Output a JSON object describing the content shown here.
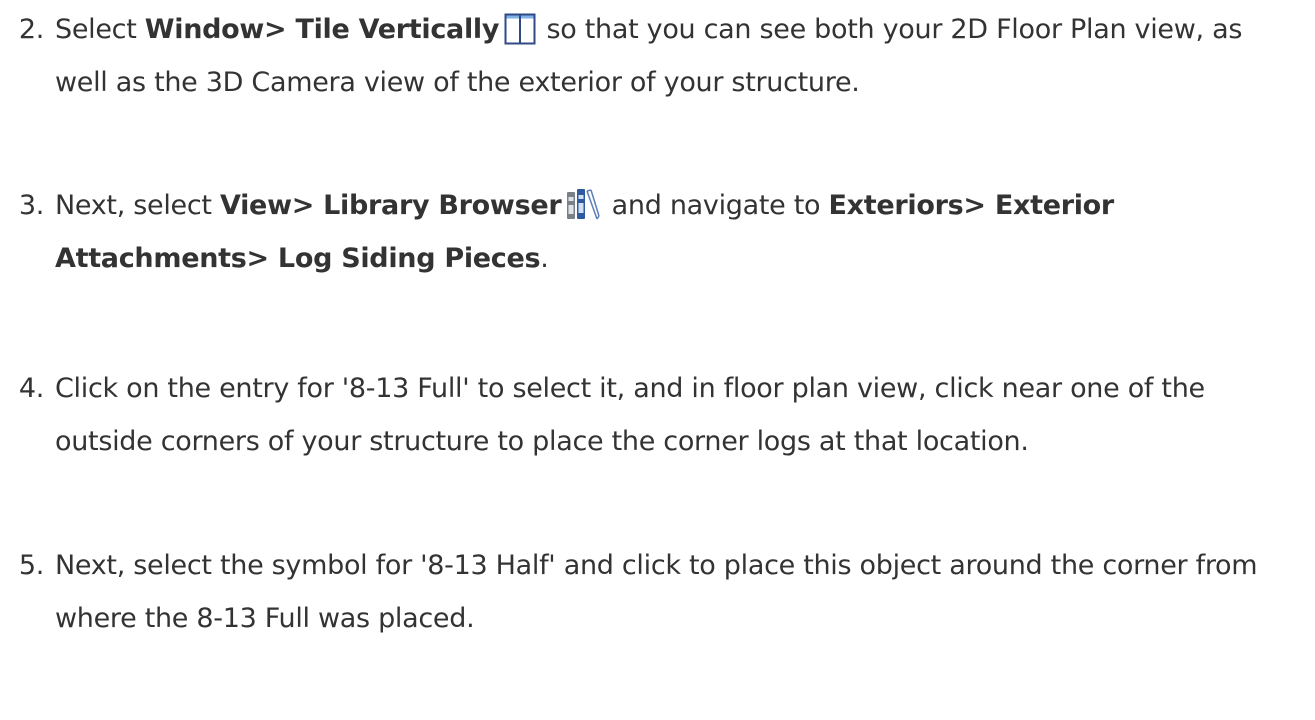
{
  "steps": [
    {
      "number": "2.",
      "t1": "Select ",
      "b1": "Window> Tile Vertically",
      "icon": "tile-vertically-icon",
      "t2": " so that you can see both your 2D Floor Plan view, as well as the 3D Camera view of the exterior of your structure."
    },
    {
      "number": "3.",
      "t1": "Next, select ",
      "b1": "View> Library Browser",
      "icon": "library-browser-icon",
      "t2": " and navigate to ",
      "b2": "Exteriors> Exterior Attachments> Log Siding Pieces",
      "t3": "."
    },
    {
      "number": "4.",
      "text": "Click on the entry for '8-13 Full' to select it, and in floor plan view, click near one of the outside corners of your structure to place the corner logs at that location."
    },
    {
      "number": "5.",
      "text": "Next, select the symbol for '8-13 Half' and click to place this object around the corner from where the 8-13 Full was placed."
    }
  ]
}
